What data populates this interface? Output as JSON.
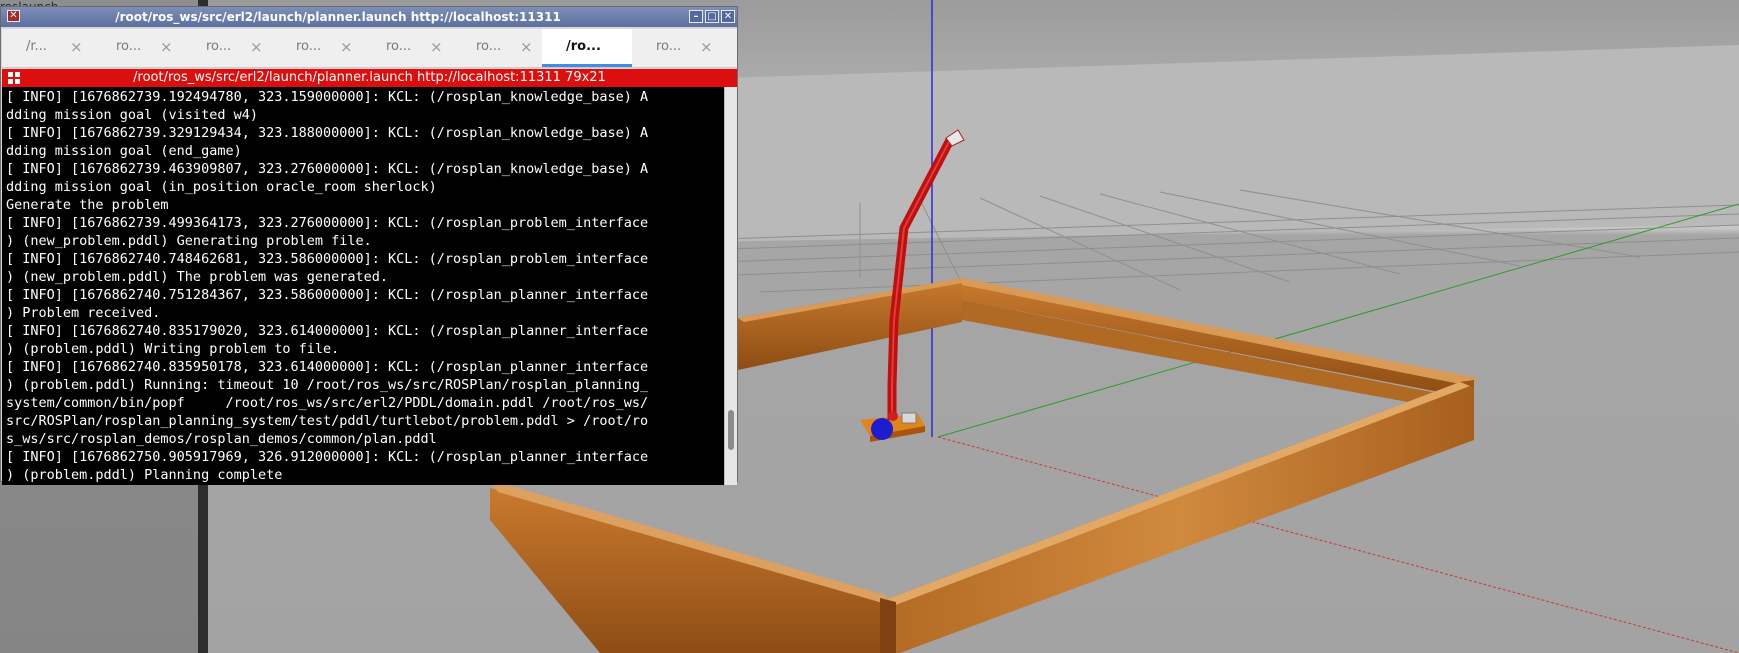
{
  "background": {
    "label": "roslaunch",
    "colors": {
      "ground": "#a9a9a9",
      "wood": "#b5651d",
      "robot_link": "#c41010"
    }
  },
  "window": {
    "title": "/root/ros_ws/src/erl2/launch/planner.launch http://localhost:11311",
    "icons": {
      "close_left": "close-icon",
      "minimize": "minimize-icon",
      "maximize": "maximize-icon",
      "close": "close-icon"
    }
  },
  "tabs": [
    {
      "label": "/r...",
      "active": false
    },
    {
      "label": "ro...",
      "active": false
    },
    {
      "label": "ro...",
      "active": false
    },
    {
      "label": "ro...",
      "active": false
    },
    {
      "label": "ro...",
      "active": false
    },
    {
      "label": "ro...",
      "active": false
    },
    {
      "label": "/ro...",
      "active": true
    },
    {
      "label": "ro...",
      "active": false
    }
  ],
  "tab_close_glyph": "×",
  "terminal": {
    "header": "/root/ros_ws/src/erl2/launch/planner.launch http://localhost:11311 79x21",
    "header_color": "#dc0e0e",
    "lines": [
      "[ INFO] [1676862739.192494780, 323.159000000]: KCL: (/rosplan_knowledge_base) A",
      "dding mission goal (visited w4)",
      "[ INFO] [1676862739.329129434, 323.188000000]: KCL: (/rosplan_knowledge_base) A",
      "dding mission goal (end_game)",
      "[ INFO] [1676862739.463909807, 323.276000000]: KCL: (/rosplan_knowledge_base) A",
      "dding mission goal (in_position oracle_room sherlock)",
      "Generate the problem",
      "[ INFO] [1676862739.499364173, 323.276000000]: KCL: (/rosplan_problem_interface",
      ") (new_problem.pddl) Generating problem file.",
      "[ INFO] [1676862740.748462681, 323.586000000]: KCL: (/rosplan_problem_interface",
      ") (new_problem.pddl) The problem was generated.",
      "[ INFO] [1676862740.751284367, 323.586000000]: KCL: (/rosplan_planner_interface",
      ") Problem received.",
      "[ INFO] [1676862740.835179020, 323.614000000]: KCL: (/rosplan_planner_interface",
      ") (problem.pddl) Writing problem to file.",
      "[ INFO] [1676862740.835950178, 323.614000000]: KCL: (/rosplan_planner_interface",
      ") (problem.pddl) Running: timeout 10 /root/ros_ws/src/ROSPlan/rosplan_planning_",
      "system/common/bin/popf     /root/ros_ws/src/erl2/PDDL/domain.pddl /root/ros_ws/",
      "src/ROSPlan/rosplan_planning_system/test/pddl/turtlebot/problem.pddl > /root/ro",
      "s_ws/src/rosplan_demos/rosplan_demos/common/plan.pddl",
      "[ INFO] [1676862750.905917969, 326.912000000]: KCL: (/rosplan_planner_interface",
      ") (problem.pddl) Planning complete"
    ]
  }
}
